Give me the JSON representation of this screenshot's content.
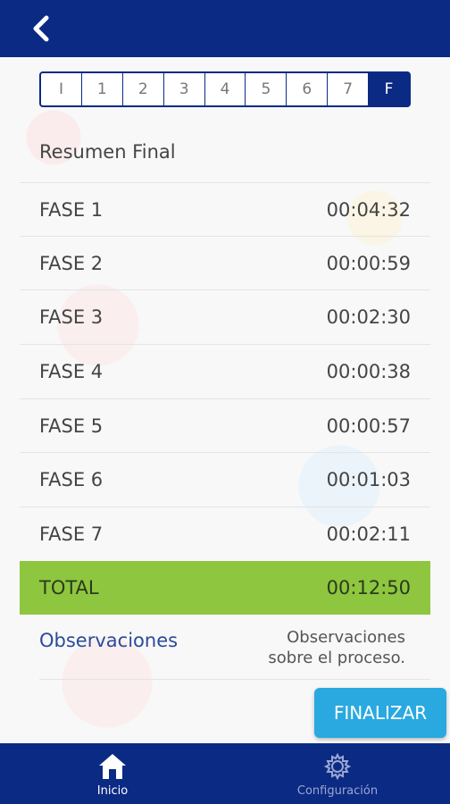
{
  "header": {
    "back_icon": "chevron-left-icon"
  },
  "stepper": {
    "steps": [
      "I",
      "1",
      "2",
      "3",
      "4",
      "5",
      "6",
      "7",
      "F"
    ],
    "active_index": 8
  },
  "summary": {
    "title": "Resumen Final",
    "rows": [
      {
        "label": "FASE 1",
        "time": "00:04:32"
      },
      {
        "label": "FASE 2",
        "time": "00:00:59"
      },
      {
        "label": "FASE 3",
        "time": "00:02:30"
      },
      {
        "label": "FASE 4",
        "time": "00:00:38"
      },
      {
        "label": "FASE 5",
        "time": "00:00:57"
      },
      {
        "label": "FASE 6",
        "time": "00:01:03"
      },
      {
        "label": "FASE 7",
        "time": "00:02:11"
      }
    ],
    "total_label": "TOTAL",
    "total_time": "00:12:50"
  },
  "observations": {
    "label": "Observaciones",
    "text_line1": "Observaciones",
    "text_line2": "sobre el proceso."
  },
  "actions": {
    "finalize_label": "FINALIZAR"
  },
  "bottom_nav": {
    "inicio_label": "Inicio",
    "config_label": "Configuración"
  },
  "colors": {
    "primary": "#0b2a84",
    "total_bg": "#8ec63f",
    "button": "#29a9e0"
  }
}
